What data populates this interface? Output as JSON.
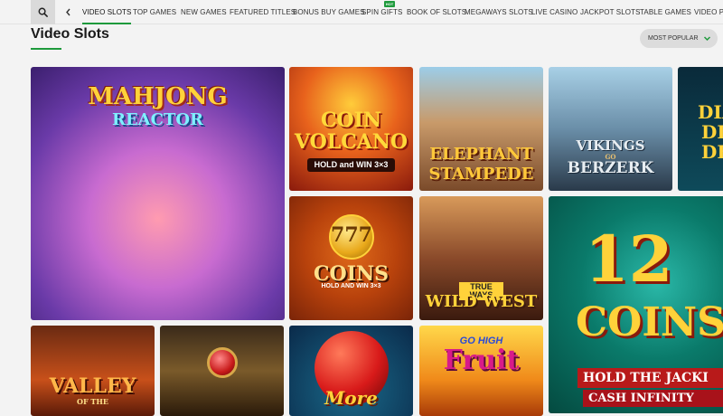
{
  "nav": {
    "tabs": [
      {
        "label": "VIDEO SLOTS",
        "active": true
      },
      {
        "label": "TOP GAMES"
      },
      {
        "label": "NEW GAMES"
      },
      {
        "label": "FEATURED TITLES"
      },
      {
        "label": "BONUS BUY GAMES"
      },
      {
        "label": "SPIN GIFTS",
        "badge": "HOT"
      },
      {
        "label": "BOOK OF SLOTS"
      },
      {
        "label": "MEGAWAYS SLOTS"
      },
      {
        "label": "LIVE CASINO"
      },
      {
        "label": "JACKPOT SLOTS"
      },
      {
        "label": "TABLE GAMES"
      },
      {
        "label": "VIDEO PO"
      }
    ],
    "hot_badge": "HOT"
  },
  "page": {
    "title": "Video Slots",
    "sort_label": "MOST POPULAR"
  },
  "games": {
    "mahjong": {
      "line1": "MAHJONG",
      "line2": "REACTOR"
    },
    "coin_volcano": {
      "line1": "COIN",
      "line2": "VOLCANO",
      "line3": "HOLD and WIN 3×3"
    },
    "elephant": {
      "line1": "ELEPHANT",
      "line2": "STAMPEDE"
    },
    "vikings": {
      "line1": "VIKINGS",
      "line2": "GO",
      "line3": "BERZERK"
    },
    "diamond": {
      "line1": "DIA",
      "line2": "DI",
      "line3": "DE"
    },
    "coins": {
      "num": "777",
      "line1": "COINS",
      "line2": "HOLD AND WIN 3×3"
    },
    "wild_west": {
      "line1": "TRUE WAYS",
      "line2": "WILD WEST"
    },
    "coins12": {
      "line1": "12",
      "line2": "COINS",
      "line3": "HOLD THE JACKI",
      "line4": "CASH INFINITY"
    },
    "valley": {
      "line1": "VALLEY",
      "line2": "OF THE"
    },
    "apple": {
      "line1": "More"
    },
    "go_high": {
      "line1": "GO HIGH",
      "line2": "Fruit"
    }
  },
  "colors": {
    "accent": "#1e9a3c",
    "background": "#f3f3f3"
  }
}
